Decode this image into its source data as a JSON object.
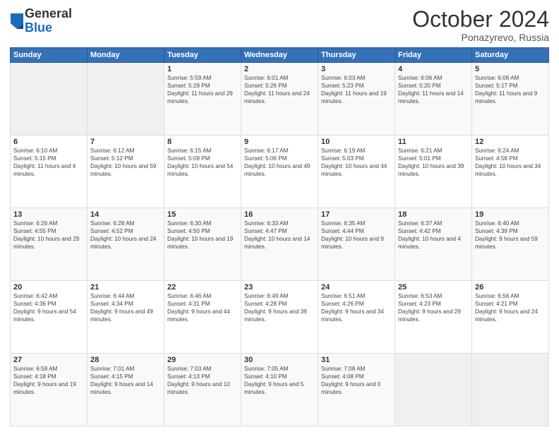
{
  "header": {
    "logo_general": "General",
    "logo_blue": "Blue",
    "month": "October 2024",
    "location": "Ponazyrevo, Russia"
  },
  "weekdays": [
    "Sunday",
    "Monday",
    "Tuesday",
    "Wednesday",
    "Thursday",
    "Friday",
    "Saturday"
  ],
  "weeks": [
    [
      {
        "day": "",
        "sunrise": "",
        "sunset": "",
        "daylight": ""
      },
      {
        "day": "",
        "sunrise": "",
        "sunset": "",
        "daylight": ""
      },
      {
        "day": "1",
        "sunrise": "Sunrise: 5:59 AM",
        "sunset": "Sunset: 5:29 PM",
        "daylight": "Daylight: 11 hours and 29 minutes."
      },
      {
        "day": "2",
        "sunrise": "Sunrise: 6:01 AM",
        "sunset": "Sunset: 5:26 PM",
        "daylight": "Daylight: 11 hours and 24 minutes."
      },
      {
        "day": "3",
        "sunrise": "Sunrise: 6:03 AM",
        "sunset": "Sunset: 5:23 PM",
        "daylight": "Daylight: 11 hours and 19 minutes."
      },
      {
        "day": "4",
        "sunrise": "Sunrise: 6:06 AM",
        "sunset": "Sunset: 5:20 PM",
        "daylight": "Daylight: 11 hours and 14 minutes."
      },
      {
        "day": "5",
        "sunrise": "Sunrise: 6:08 AM",
        "sunset": "Sunset: 5:17 PM",
        "daylight": "Daylight: 11 hours and 9 minutes."
      }
    ],
    [
      {
        "day": "6",
        "sunrise": "Sunrise: 6:10 AM",
        "sunset": "Sunset: 5:15 PM",
        "daylight": "Daylight: 11 hours and 4 minutes."
      },
      {
        "day": "7",
        "sunrise": "Sunrise: 6:12 AM",
        "sunset": "Sunset: 5:12 PM",
        "daylight": "Daylight: 10 hours and 59 minutes."
      },
      {
        "day": "8",
        "sunrise": "Sunrise: 6:15 AM",
        "sunset": "Sunset: 5:09 PM",
        "daylight": "Daylight: 10 hours and 54 minutes."
      },
      {
        "day": "9",
        "sunrise": "Sunrise: 6:17 AM",
        "sunset": "Sunset: 5:06 PM",
        "daylight": "Daylight: 10 hours and 49 minutes."
      },
      {
        "day": "10",
        "sunrise": "Sunrise: 6:19 AM",
        "sunset": "Sunset: 5:03 PM",
        "daylight": "Daylight: 10 hours and 44 minutes."
      },
      {
        "day": "11",
        "sunrise": "Sunrise: 6:21 AM",
        "sunset": "Sunset: 5:01 PM",
        "daylight": "Daylight: 10 hours and 39 minutes."
      },
      {
        "day": "12",
        "sunrise": "Sunrise: 6:24 AM",
        "sunset": "Sunset: 4:58 PM",
        "daylight": "Daylight: 10 hours and 34 minutes."
      }
    ],
    [
      {
        "day": "13",
        "sunrise": "Sunrise: 6:26 AM",
        "sunset": "Sunset: 4:55 PM",
        "daylight": "Daylight: 10 hours and 29 minutes."
      },
      {
        "day": "14",
        "sunrise": "Sunrise: 6:28 AM",
        "sunset": "Sunset: 4:52 PM",
        "daylight": "Daylight: 10 hours and 24 minutes."
      },
      {
        "day": "15",
        "sunrise": "Sunrise: 6:30 AM",
        "sunset": "Sunset: 4:50 PM",
        "daylight": "Daylight: 10 hours and 19 minutes."
      },
      {
        "day": "16",
        "sunrise": "Sunrise: 6:33 AM",
        "sunset": "Sunset: 4:47 PM",
        "daylight": "Daylight: 10 hours and 14 minutes."
      },
      {
        "day": "17",
        "sunrise": "Sunrise: 6:35 AM",
        "sunset": "Sunset: 4:44 PM",
        "daylight": "Daylight: 10 hours and 9 minutes."
      },
      {
        "day": "18",
        "sunrise": "Sunrise: 6:37 AM",
        "sunset": "Sunset: 4:42 PM",
        "daylight": "Daylight: 10 hours and 4 minutes."
      },
      {
        "day": "19",
        "sunrise": "Sunrise: 6:40 AM",
        "sunset": "Sunset: 4:39 PM",
        "daylight": "Daylight: 9 hours and 59 minutes."
      }
    ],
    [
      {
        "day": "20",
        "sunrise": "Sunrise: 6:42 AM",
        "sunset": "Sunset: 4:36 PM",
        "daylight": "Daylight: 9 hours and 54 minutes."
      },
      {
        "day": "21",
        "sunrise": "Sunrise: 6:44 AM",
        "sunset": "Sunset: 4:34 PM",
        "daylight": "Daylight: 9 hours and 49 minutes."
      },
      {
        "day": "22",
        "sunrise": "Sunrise: 6:46 AM",
        "sunset": "Sunset: 4:31 PM",
        "daylight": "Daylight: 9 hours and 44 minutes."
      },
      {
        "day": "23",
        "sunrise": "Sunrise: 6:49 AM",
        "sunset": "Sunset: 4:28 PM",
        "daylight": "Daylight: 9 hours and 39 minutes."
      },
      {
        "day": "24",
        "sunrise": "Sunrise: 6:51 AM",
        "sunset": "Sunset: 4:26 PM",
        "daylight": "Daylight: 9 hours and 34 minutes."
      },
      {
        "day": "25",
        "sunrise": "Sunrise: 6:53 AM",
        "sunset": "Sunset: 4:23 PM",
        "daylight": "Daylight: 9 hours and 29 minutes."
      },
      {
        "day": "26",
        "sunrise": "Sunrise: 6:56 AM",
        "sunset": "Sunset: 4:21 PM",
        "daylight": "Daylight: 9 hours and 24 minutes."
      }
    ],
    [
      {
        "day": "27",
        "sunrise": "Sunrise: 6:58 AM",
        "sunset": "Sunset: 4:18 PM",
        "daylight": "Daylight: 9 hours and 19 minutes."
      },
      {
        "day": "28",
        "sunrise": "Sunrise: 7:01 AM",
        "sunset": "Sunset: 4:15 PM",
        "daylight": "Daylight: 9 hours and 14 minutes."
      },
      {
        "day": "29",
        "sunrise": "Sunrise: 7:03 AM",
        "sunset": "Sunset: 4:13 PM",
        "daylight": "Daylight: 9 hours and 10 minutes."
      },
      {
        "day": "30",
        "sunrise": "Sunrise: 7:05 AM",
        "sunset": "Sunset: 4:10 PM",
        "daylight": "Daylight: 9 hours and 5 minutes."
      },
      {
        "day": "31",
        "sunrise": "Sunrise: 7:08 AM",
        "sunset": "Sunset: 4:08 PM",
        "daylight": "Daylight: 9 hours and 0 minutes."
      },
      {
        "day": "",
        "sunrise": "",
        "sunset": "",
        "daylight": ""
      },
      {
        "day": "",
        "sunrise": "",
        "sunset": "",
        "daylight": ""
      }
    ]
  ]
}
